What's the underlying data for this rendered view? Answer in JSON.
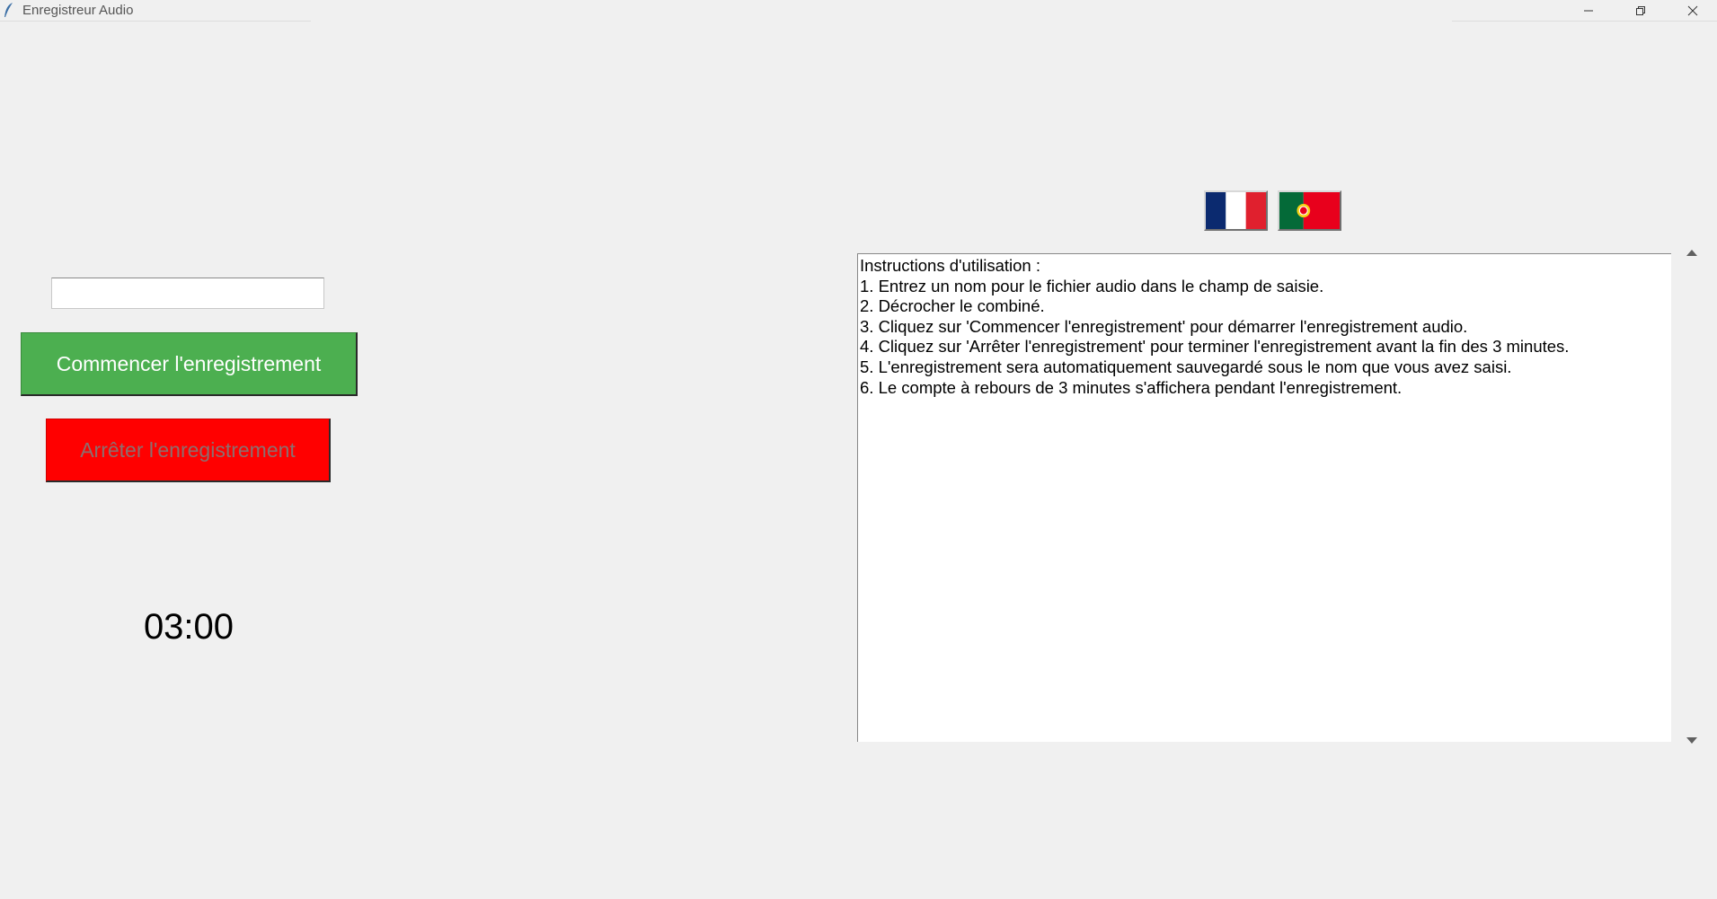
{
  "window": {
    "title": "Enregistreur Audio"
  },
  "form": {
    "name_value": ""
  },
  "buttons": {
    "start_label": "Commencer l'enregistrement",
    "stop_label": "Arrêter l'enregistrement"
  },
  "timer": {
    "value": "03:00"
  },
  "languages": [
    {
      "code": "fr",
      "icon": "france-flag-icon"
    },
    {
      "code": "pt",
      "icon": "portugal-flag-icon"
    }
  ],
  "instructions": {
    "title": "Instructions d'utilisation :",
    "lines": [
      "1. Entrez un nom pour le fichier audio dans le champ de saisie.",
      "2. Décrocher le combiné.",
      "3. Cliquez sur 'Commencer l'enregistrement' pour démarrer l'enregistrement audio.",
      "4. Cliquez sur 'Arrêter l'enregistrement' pour terminer l'enregistrement avant la fin des 3 minutes.",
      "5. L'enregistrement sera automatiquement sauvegardé sous le nom que vous avez saisi.",
      "6. Le compte à rebours de 3 minutes s'affichera pendant l'enregistrement."
    ]
  },
  "colors": {
    "start_button": "#4caf50",
    "stop_button": "#ff0000",
    "stop_text": "#8b6f6f",
    "background": "#f0f0f0"
  }
}
